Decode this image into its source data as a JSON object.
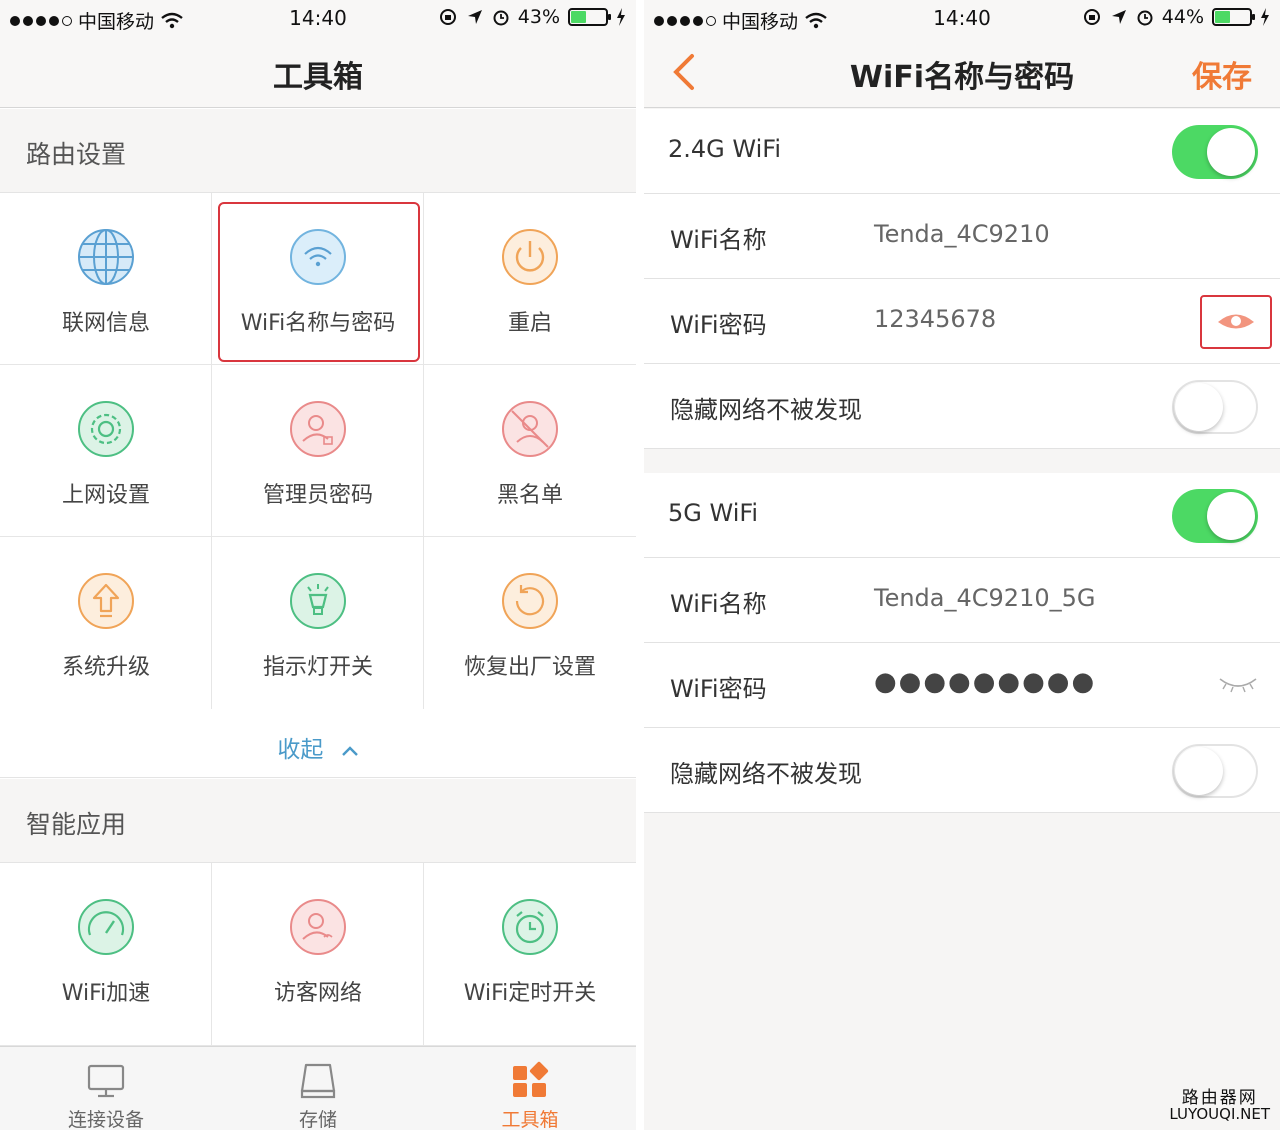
{
  "status_left": {
    "carrier": "中国移动",
    "time": "14:40",
    "battery": "43%",
    "battery_level": 0.43
  },
  "status_right": {
    "carrier": "中国移动",
    "time": "14:40",
    "battery": "44%",
    "battery_level": 0.44
  },
  "toolbox": {
    "title": "工具箱",
    "router_section": "路由设置",
    "router_items": [
      {
        "label": "联网信息",
        "icon": "globe-icon"
      },
      {
        "label": "WiFi名称与密码",
        "icon": "wifi-icon"
      },
      {
        "label": "重启",
        "icon": "power-icon"
      },
      {
        "label": "上网设置",
        "icon": "gear-icon"
      },
      {
        "label": "管理员密码",
        "icon": "admin-lock-icon"
      },
      {
        "label": "黑名单",
        "icon": "blacklist-icon"
      },
      {
        "label": "系统升级",
        "icon": "upgrade-arrow-icon"
      },
      {
        "label": "指示灯开关",
        "icon": "indicator-light-icon"
      },
      {
        "label": "恢复出厂设置",
        "icon": "restore-icon"
      }
    ],
    "collapse": "收起",
    "smart_section": "智能应用",
    "smart_items": [
      {
        "label": "WiFi加速",
        "icon": "speedometer-icon"
      },
      {
        "label": "访客网络",
        "icon": "guest-network-icon"
      },
      {
        "label": "WiFi定时开关",
        "icon": "alarm-clock-icon"
      }
    ],
    "tabs": [
      {
        "label": "连接设备",
        "icon": "monitor-icon"
      },
      {
        "label": "存储",
        "icon": "storage-icon"
      },
      {
        "label": "工具箱",
        "icon": "toolbox-icon"
      }
    ],
    "active_tab": "工具箱"
  },
  "wifi": {
    "title": "WiFi名称与密码",
    "save": "保存",
    "band24": {
      "label": "2.4G WiFi",
      "enabled": true,
      "name_label": "WiFi名称",
      "name": "Tenda_4C9210",
      "pw_label": "WiFi密码",
      "pw": "12345678",
      "hide_label": "隐藏网络不被发现",
      "hidden": false
    },
    "band5": {
      "label": "5G WiFi",
      "enabled": true,
      "name_label": "WiFi名称",
      "name": "Tenda_4C9210_5G",
      "pw_label": "WiFi密码",
      "pw": "●●●●●●●●●",
      "hide_label": "隐藏网络不被发现",
      "hidden": false
    }
  },
  "watermark": {
    "cn": "路由器网",
    "en": "LUYOUQI.NET"
  },
  "colors": {
    "accent": "#f07a36",
    "toggle_on": "#4cd964",
    "highlight": "#d9363e",
    "link": "#4a9ac9"
  }
}
